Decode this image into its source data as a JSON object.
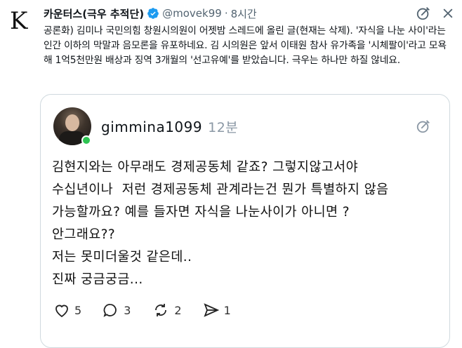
{
  "post": {
    "author_avatar_letter": "K",
    "author_name": "카운터스(극우 추적단)",
    "handle": "@movek99",
    "separator": "·",
    "time": "8시간",
    "text": "공론화) 김미나 국민의힘 창원시의원이 어젯밤 스레드에 올린 글(현재는 삭제). '자식을 나눈 사이'라는 인간 이하의 막말과 음모론을 유포하네요. 김 시의원은 앞서 이태원 참사 유가족을 '시체팔이'라고 모욕해 1억5천만원 배상과 징역 3개월의 '선고유예'를 받았습니다. 극우는 하나만 하질 않네요."
  },
  "quoted": {
    "username": "gimmina1099",
    "time": "12분",
    "lines": [
      "김현지와는 아무래도 경제공동체 같죠? 그렇지않고서야",
      "수십년이나  저런 경제공동체 관계라는건 뭔가 특별하지 않음",
      "가능할까요? 예를 들자면 자식을 나눈사이가 아니면 ?",
      "안그래요??",
      "저는 못미더울것 같은데..",
      "진짜 궁금궁금..."
    ],
    "actions": {
      "likes": "5",
      "replies": "3",
      "reposts": "2",
      "shares": "1"
    }
  },
  "colors": {
    "verified": "#1d9bf0",
    "online": "#2ec452",
    "muted": "#536471"
  }
}
